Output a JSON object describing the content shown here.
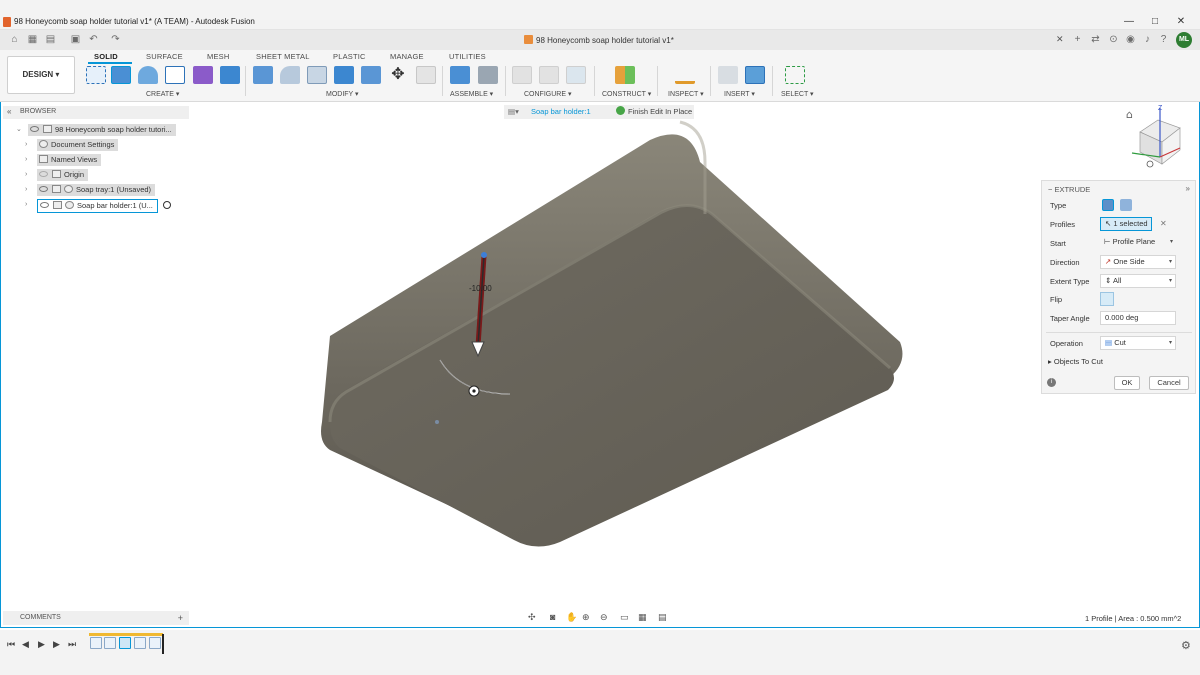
{
  "window": {
    "title": "98 Honeycomb soap holder tutorial v1* (A TEAM) - Autodesk Fusion",
    "minimize": "—",
    "maximize": "□",
    "close": "✕"
  },
  "doc_tab": {
    "title": "98 Honeycomb soap holder tutorial v1*",
    "close": "✕",
    "avatar": "ML"
  },
  "toolbar": {
    "workspace": "DESIGN ▾",
    "tabs": [
      "SOLID",
      "SURFACE",
      "MESH",
      "SHEET METAL",
      "PLASTIC",
      "MANAGE",
      "UTILITIES"
    ],
    "active_tab": "SOLID",
    "groups": [
      "CREATE ▾",
      "MODIFY ▾",
      "ASSEMBLE ▾",
      "CONFIGURE ▾",
      "CONSTRUCT ▾",
      "INSPECT ▾",
      "INSERT ▾",
      "SELECT ▾"
    ]
  },
  "browser": {
    "header": "BROWSER",
    "items": [
      {
        "label": "98 Honeycomb soap holder tutori..."
      },
      {
        "label": "Document Settings"
      },
      {
        "label": "Named Views"
      },
      {
        "label": "Origin"
      },
      {
        "label": "Soap tray:1 (Unsaved)"
      },
      {
        "label": "Soap bar holder:1 (U..."
      }
    ]
  },
  "context_bar": {
    "component": "Soap bar holder:1",
    "finish": "Finish Edit In Place"
  },
  "viewport": {
    "dimension": "-10.00"
  },
  "extrude": {
    "title": "EXTRUDE",
    "type_label": "Type",
    "profiles_label": "Profiles",
    "profiles_value": "1 selected",
    "start_label": "Start",
    "start_value": "Profile Plane",
    "direction_label": "Direction",
    "direction_value": "One Side",
    "extent_label": "Extent Type",
    "extent_value": "All",
    "flip_label": "Flip",
    "taper_label": "Taper Angle",
    "taper_value": "0.000 deg",
    "operation_label": "Operation",
    "operation_value": "Cut",
    "objects_to_cut": "Objects To Cut",
    "ok": "OK",
    "cancel": "Cancel"
  },
  "comments": {
    "label": "COMMENTS"
  },
  "status": {
    "text": "1 Profile | Area : 0.500 mm^2"
  },
  "colors": {
    "accent": "#0696d7",
    "body": "#6a665c"
  }
}
